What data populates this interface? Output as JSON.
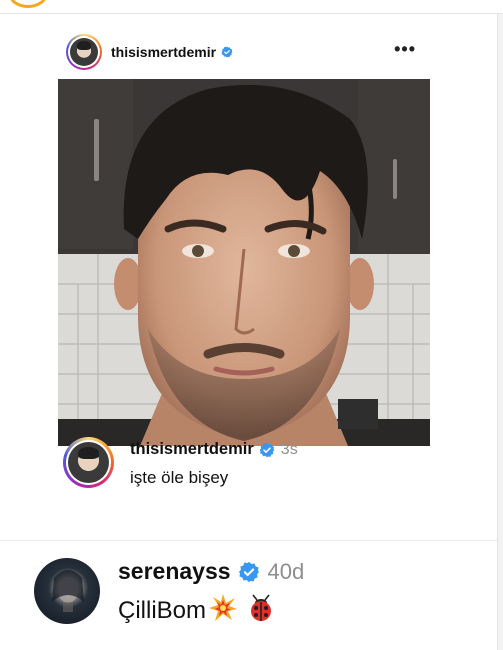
{
  "post": {
    "username": "thisismertdemir",
    "more_label": "•••"
  },
  "comments": [
    {
      "username": "thisismertdemir",
      "time": "3s",
      "text": "işte öle bişey"
    },
    {
      "username": "serenayss",
      "time": "40d",
      "text": "ÇilliBom"
    }
  ],
  "icons": {
    "verified": "verified-badge-icon",
    "more": "more-options-icon",
    "emoji1": "collision-emoji",
    "emoji2": "ladybug-emoji"
  },
  "colors": {
    "verified": "#3897f0",
    "secondary_text": "#8e8e8e",
    "story_ring_start": "#feda75",
    "story_ring_end": "#4f5bd5"
  }
}
